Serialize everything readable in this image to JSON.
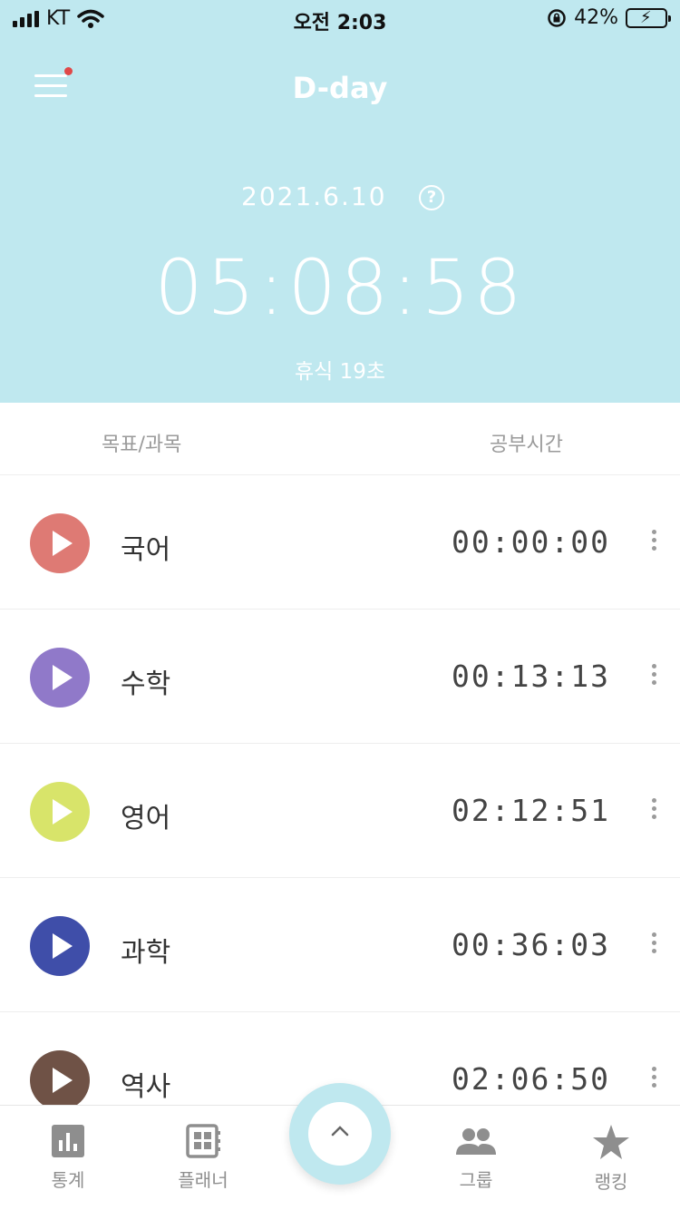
{
  "status": {
    "carrier": "KT",
    "time": "오전 2:03",
    "battery": "42%",
    "battery_level": 42
  },
  "header": {
    "title": "D-day",
    "date": "2021.6.10",
    "help": "?",
    "timer": "05:08:58",
    "rest": "휴식 19초"
  },
  "list_header": {
    "subject": "목표/과목",
    "study_time": "공부시간"
  },
  "subjects": [
    {
      "name": "국어",
      "time": "00:00:00",
      "color": "#de7a74"
    },
    {
      "name": "수학",
      "time": "00:13:13",
      "color": "#9079c9"
    },
    {
      "name": "영어",
      "time": "02:12:51",
      "color": "#d8e46a"
    },
    {
      "name": "과학",
      "time": "00:36:03",
      "color": "#3f4ea9"
    },
    {
      "name": "역사",
      "time": "02:06:50",
      "color": "#6f5246"
    }
  ],
  "tabs": {
    "stats": "통계",
    "planner": "플래너",
    "group": "그룹",
    "ranking": "랭킹"
  },
  "colors": {
    "header_bg": "#bfe8ef",
    "notification_dot": "#e04848"
  }
}
